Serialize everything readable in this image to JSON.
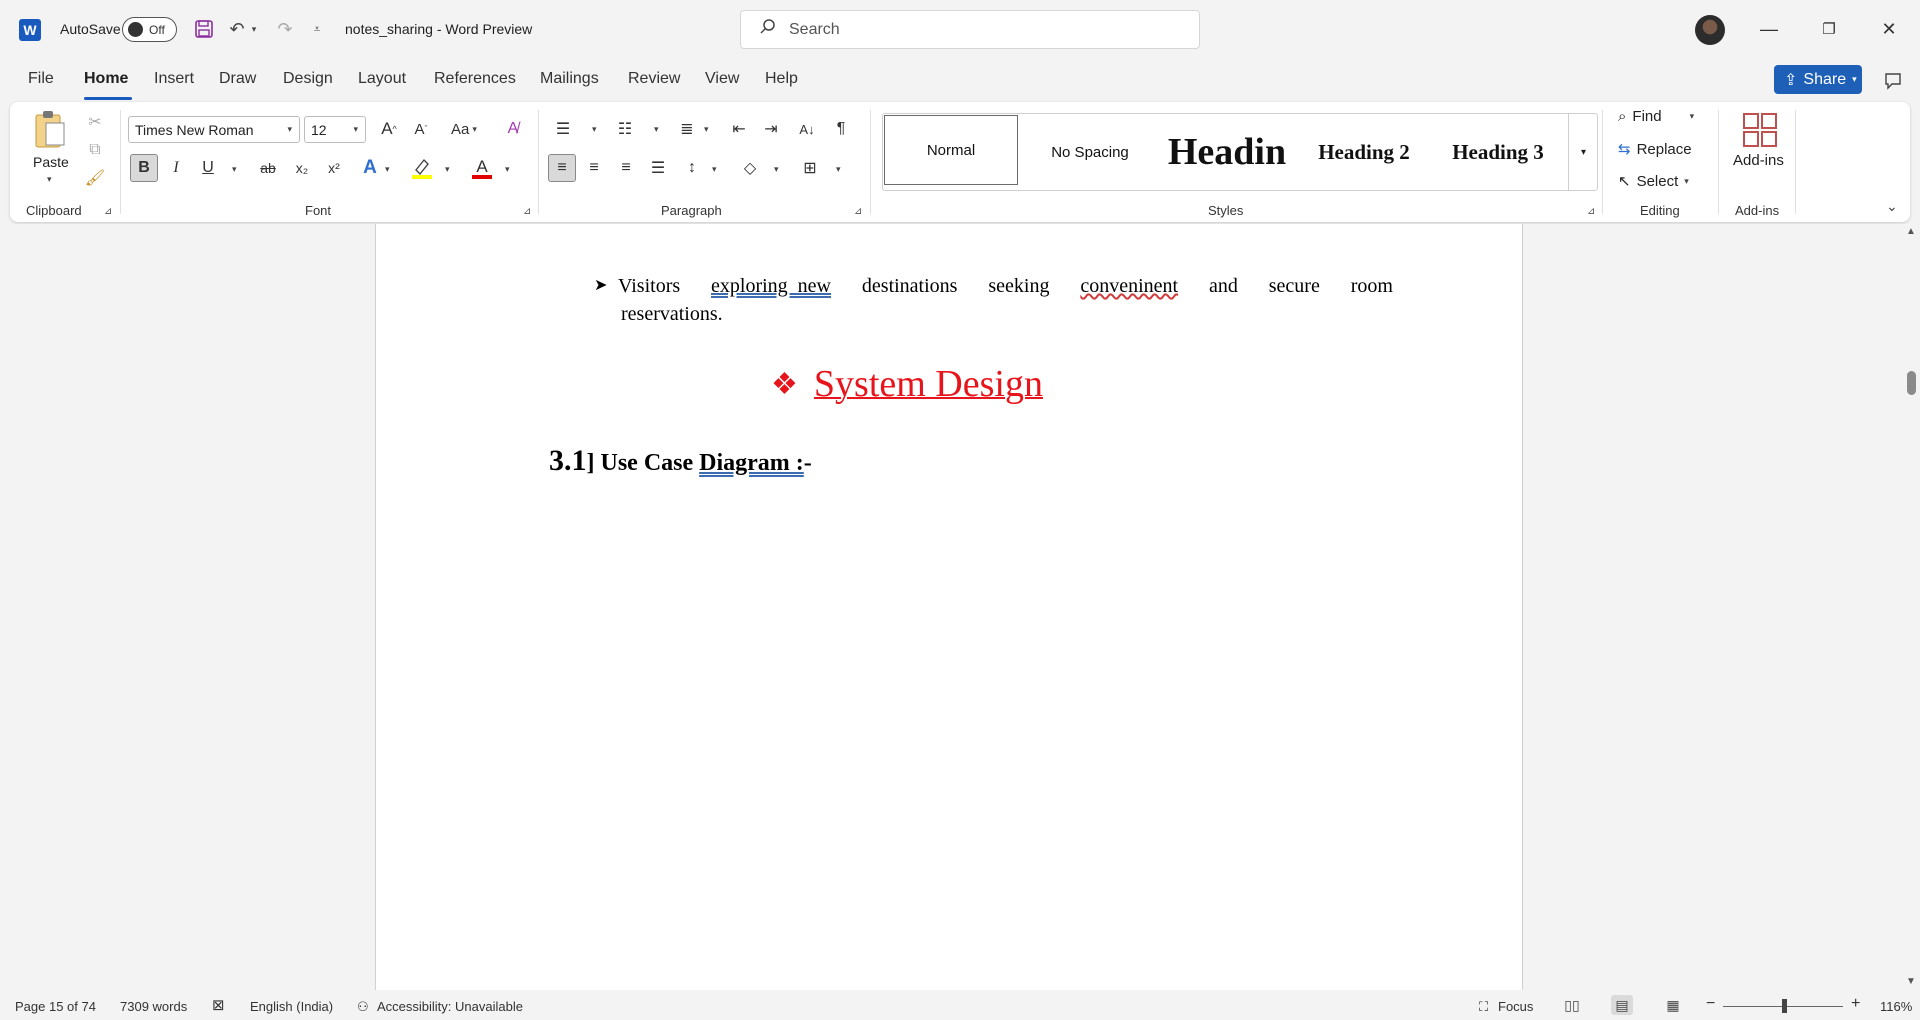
{
  "titlebar": {
    "app_logo": "W",
    "autosave_label": "AutoSave",
    "autosave_state": "Off",
    "doc_title": "notes_sharing  -  Word Preview",
    "search_placeholder": "Search",
    "icons": [
      "save-icon",
      "undo-icon",
      "redo-icon",
      "customize-icon"
    ]
  },
  "tabs": [
    "File",
    "Home",
    "Insert",
    "Draw",
    "Design",
    "Layout",
    "References",
    "Mailings",
    "Review",
    "View",
    "Help"
  ],
  "active_tab": "Home",
  "share_label": "Share",
  "ribbon": {
    "clipboard": {
      "paste_label": "Paste",
      "group_label": "Clipboard"
    },
    "font": {
      "family": "Times New Roman",
      "size": "12",
      "group_label": "Font",
      "bold": "B",
      "italic": "I",
      "underline": "U",
      "strike": "ab",
      "subscript": "x₂",
      "superscript": "x²",
      "change_case": "Aa",
      "font_color_letter": "A",
      "highlight_color": "#ffff00",
      "font_color": "#e00000"
    },
    "paragraph": {
      "group_label": "Paragraph"
    },
    "styles": {
      "group_label": "Styles",
      "items": [
        "Normal",
        "No Spacing",
        "Headin",
        "Heading 2",
        "Heading 3"
      ]
    },
    "editing": {
      "group_label": "Editing",
      "find": "Find",
      "replace": "Replace",
      "select": "Select"
    },
    "addins": {
      "group_label": "Add-ins",
      "label": "Add-ins"
    }
  },
  "document": {
    "bullet_words": [
      "Visitors",
      "exploring  new",
      "destinations",
      "seeking",
      "conveninent",
      "and",
      "secure",
      "room"
    ],
    "bullet_line2": "reservations.",
    "section_title": "System Design",
    "section_color": "#e8141b",
    "heading_num": "3.1",
    "heading_part1": "] Use Case ",
    "heading_part2": "Diagram :",
    "heading_part3": "-"
  },
  "statusbar": {
    "page": "Page 15 of 74",
    "words": "7309 words",
    "language": "English (India)",
    "accessibility": "Accessibility: Unavailable",
    "focus": "Focus",
    "zoom": "116%"
  },
  "colors": {
    "accent": "#185abd",
    "share": "#1e5fb8"
  }
}
